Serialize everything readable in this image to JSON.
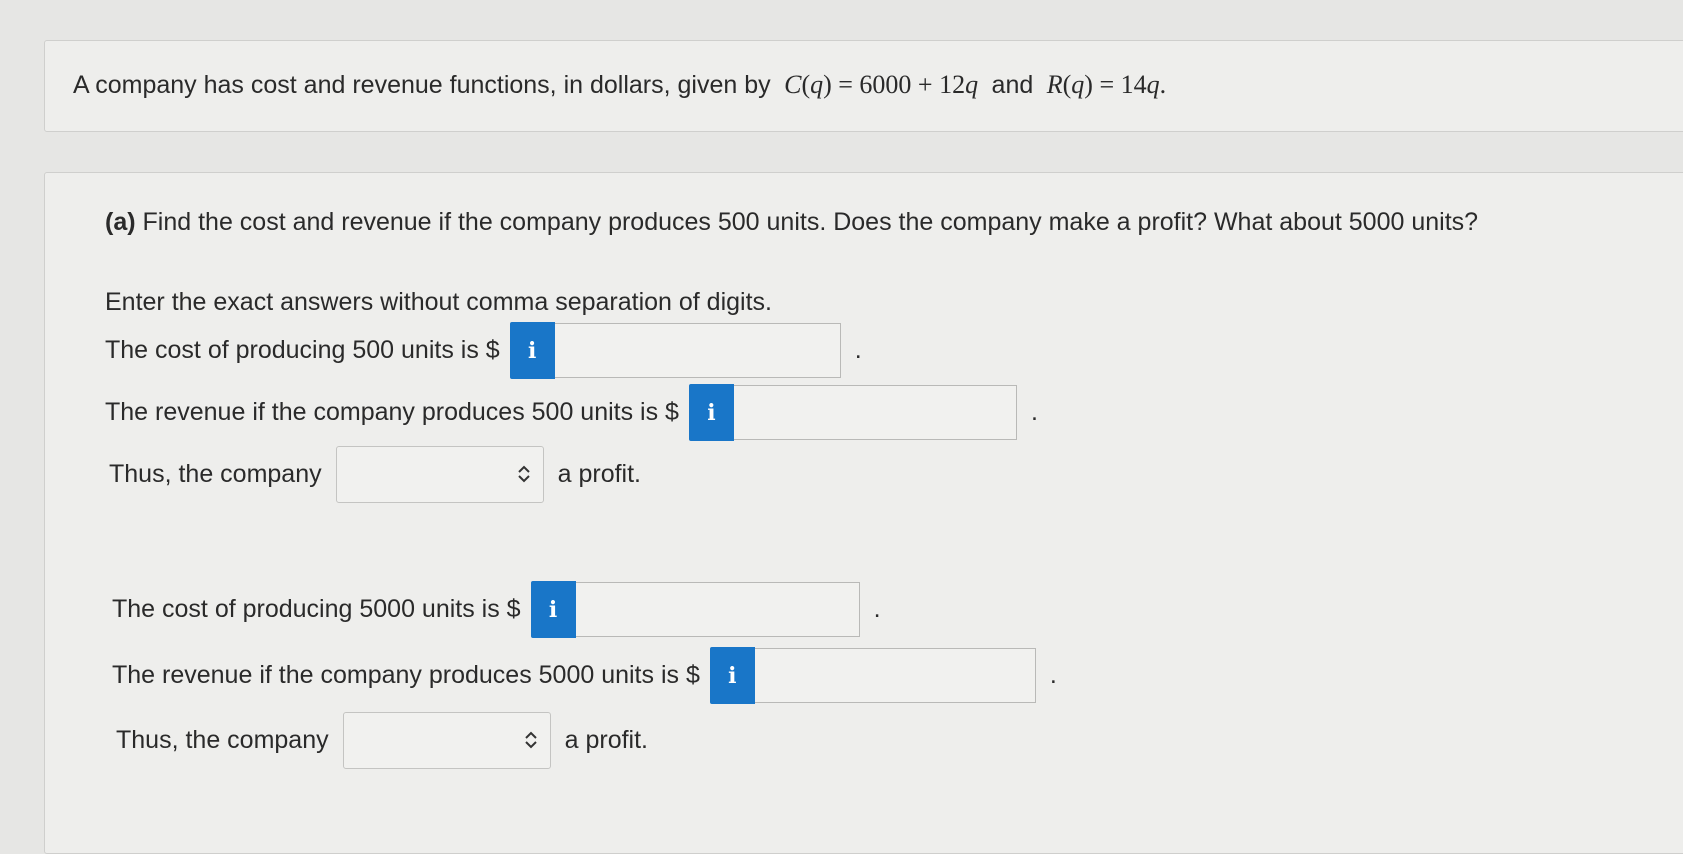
{
  "statement": {
    "prefix": "A company has cost and revenue functions, in dollars, given by",
    "cost_fn": "C(q) = 6000 + 12q",
    "and": "and",
    "revenue_fn": "R(q) = 14q."
  },
  "part_a": {
    "label": "(a)",
    "question": "Find the cost and revenue if the company produces 500 units. Does the company make a profit? What about 5000 units?",
    "instructions": "Enter the exact answers without comma separation of digits."
  },
  "rows": {
    "cost_500": {
      "label": "The cost of producing 500 units is $",
      "value": "",
      "suffix": "."
    },
    "revenue_500": {
      "label": "The revenue if the company produces 500 units is $",
      "value": "",
      "suffix": "."
    },
    "profit_500": {
      "prefix": "Thus, the company",
      "selected": "",
      "suffix": "a profit."
    },
    "cost_5000": {
      "label": "The cost of producing 5000 units is $",
      "value": "",
      "suffix": "."
    },
    "revenue_5000": {
      "label": "The revenue if the company produces 5000 units is $",
      "value": "",
      "suffix": "."
    },
    "profit_5000": {
      "prefix": "Thus, the company",
      "selected": "",
      "suffix": "a profit."
    }
  },
  "info_icon_glyph": "i",
  "icons": {
    "info": "info-icon",
    "select": "chevron-up-down-icon"
  },
  "colors": {
    "info_button": "#1976c8",
    "background": "#e6e6e4"
  }
}
